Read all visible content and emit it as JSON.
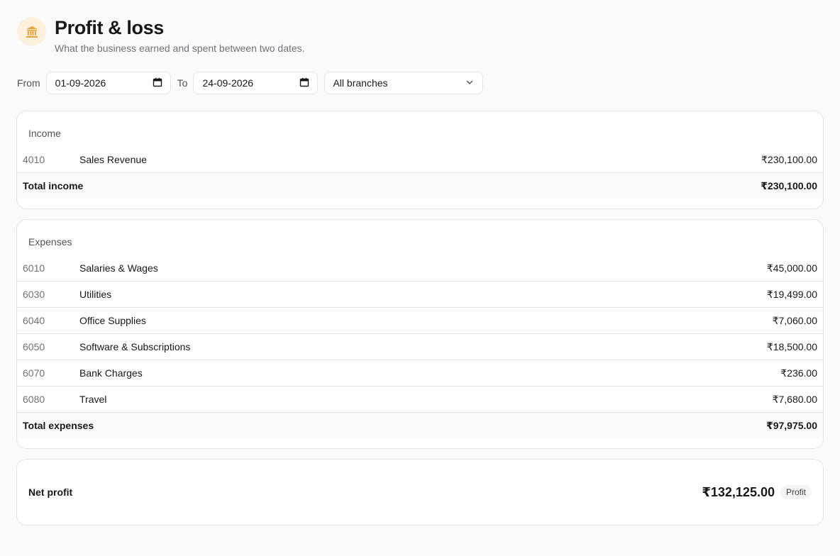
{
  "header": {
    "icon": "bank-icon",
    "title": "Profit & loss",
    "subtitle": "What the business earned and spent between two dates."
  },
  "filters": {
    "from_label": "From",
    "from_value": "01-09-2026",
    "to_label": "To",
    "to_value": "24-09-2026",
    "branch_value": "All branches"
  },
  "income": {
    "title": "Income",
    "rows": [
      {
        "code": "4010",
        "name": "Sales Revenue",
        "amount": "₹230,100.00"
      }
    ],
    "total_label": "Total income",
    "total_value": "₹230,100.00"
  },
  "expenses": {
    "title": "Expenses",
    "rows": [
      {
        "code": "6010",
        "name": "Salaries & Wages",
        "amount": "₹45,000.00"
      },
      {
        "code": "6030",
        "name": "Utilities",
        "amount": "₹19,499.00"
      },
      {
        "code": "6040",
        "name": "Office Supplies",
        "amount": "₹7,060.00"
      },
      {
        "code": "6050",
        "name": "Software & Subscriptions",
        "amount": "₹18,500.00"
      },
      {
        "code": "6070",
        "name": "Bank Charges",
        "amount": "₹236.00"
      },
      {
        "code": "6080",
        "name": "Travel",
        "amount": "₹7,680.00"
      }
    ],
    "total_label": "Total expenses",
    "total_value": "₹97,975.00"
  },
  "net": {
    "label": "Net profit",
    "value": "₹132,125.00",
    "badge": "Profit"
  },
  "colors": {
    "accent": "#e8a33d",
    "icon_bg": "#fdf0dd",
    "border": "#e4e4e7",
    "muted_text": "#71717a"
  }
}
